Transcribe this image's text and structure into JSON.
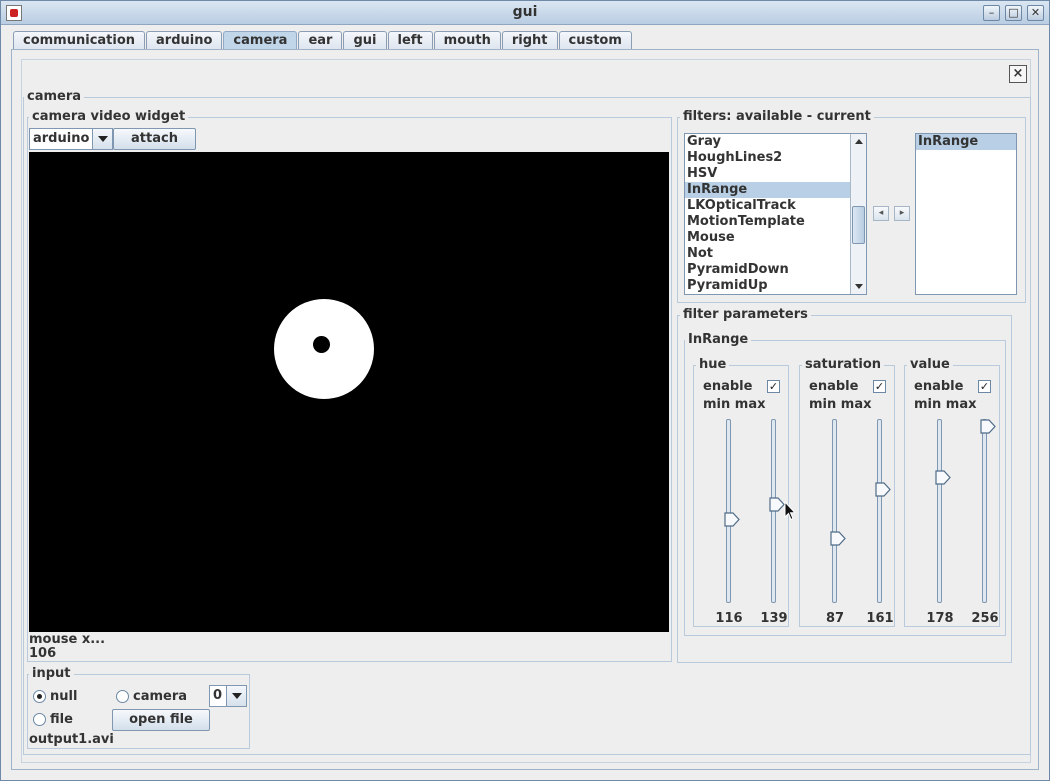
{
  "window": {
    "title": "gui"
  },
  "tabs": [
    "communication",
    "arduino",
    "camera",
    "ear",
    "gui",
    "left",
    "mouth",
    "right",
    "custom"
  ],
  "active_tab": "camera",
  "panel": {
    "title": "camera",
    "close_glyph": "×"
  },
  "video_widget": {
    "title": "camera  video widget",
    "source_combo": "arduino",
    "attach_label": "attach",
    "mouse_label": "mouse x...",
    "mouse_value": "106"
  },
  "input": {
    "title": "input",
    "null_label": "null",
    "camera_label": "camera",
    "camera_index": "0",
    "file_label": "file",
    "open_file_label": "open file",
    "filename": "output1.avi",
    "selected": "null"
  },
  "filters": {
    "title": "filters: available - current",
    "available": [
      "Gray",
      "HoughLines2",
      "HSV",
      "InRange",
      "LKOpticalTrack",
      "MotionTemplate",
      "Mouse",
      "Not",
      "PyramidDown",
      "PyramidUp"
    ],
    "selected_available": "InRange",
    "current": [
      "InRange"
    ],
    "left_glyph": "◂",
    "right_glyph": "▸"
  },
  "filter_parameters": {
    "title": "filter parameters",
    "filter_name": "InRange",
    "groups": [
      {
        "name": "hue",
        "enable_label": "enable",
        "enabled": true,
        "minmax_label": "min max",
        "min": "116",
        "max": "139",
        "min_level": 0.45,
        "max_level": 0.54
      },
      {
        "name": "saturation",
        "enable_label": "enable",
        "enabled": true,
        "minmax_label": "min max",
        "min": "87",
        "max": "161",
        "min_level": 0.34,
        "max_level": 0.63
      },
      {
        "name": "value",
        "enable_label": "enable",
        "enabled": true,
        "minmax_label": "min max",
        "min": "178",
        "max": "256",
        "min_level": 0.7,
        "max_level": 1.0
      }
    ]
  },
  "icons": {
    "app": "java-app-icon",
    "minimize": "minimize-icon",
    "maximize": "maximize-icon",
    "close": "close-icon",
    "cursor": "mouse-pointer-icon"
  },
  "colors": {
    "selection": "#b8cfe5",
    "accent": "#c2d6ea",
    "video_bg": "#000000"
  }
}
